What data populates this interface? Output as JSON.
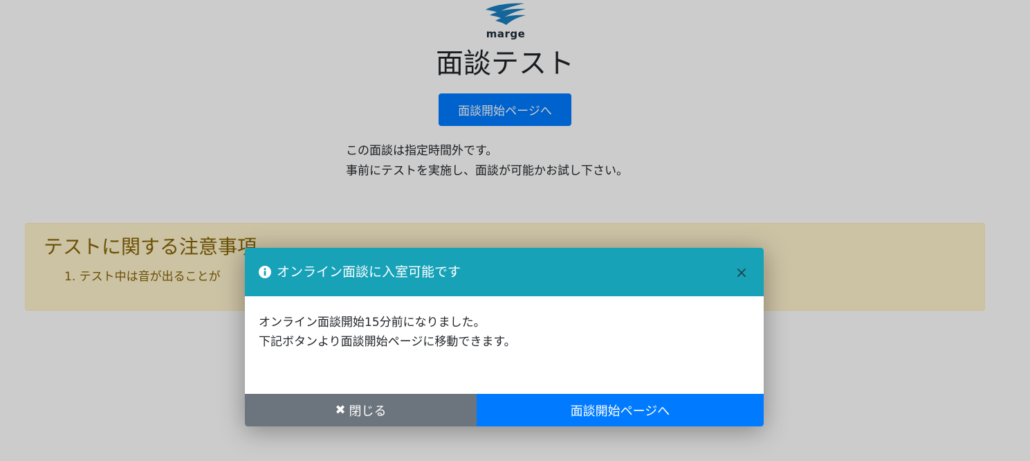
{
  "page": {
    "logo_text": "marge",
    "title": "面談テスト",
    "start_button_label": "面談開始ページへ",
    "notice_lines": [
      "この面談は指定時間外です。",
      "事前にテストを実施し、面談が可能かお試し下さい。"
    ]
  },
  "alert": {
    "title": "テストに関する注意事項",
    "items": [
      "1. テスト中は音が出ることが"
    ]
  },
  "modal": {
    "icon": "info-circle-icon",
    "title": "オンライン面談に入室可能です",
    "close_symbol": "×",
    "body_lines": [
      "オンライン面談開始15分前になりました。",
      "下記ボタンより面談開始ページに移動できます。"
    ],
    "close_button_icon": "✖",
    "close_button_label": "閉じる",
    "start_button_label": "面談開始ページへ"
  },
  "colors": {
    "primary": "#007bff",
    "info": "#17a2b8",
    "secondary": "#6c757d",
    "warning_bg": "#fff3cd",
    "warning_text": "#856404"
  }
}
